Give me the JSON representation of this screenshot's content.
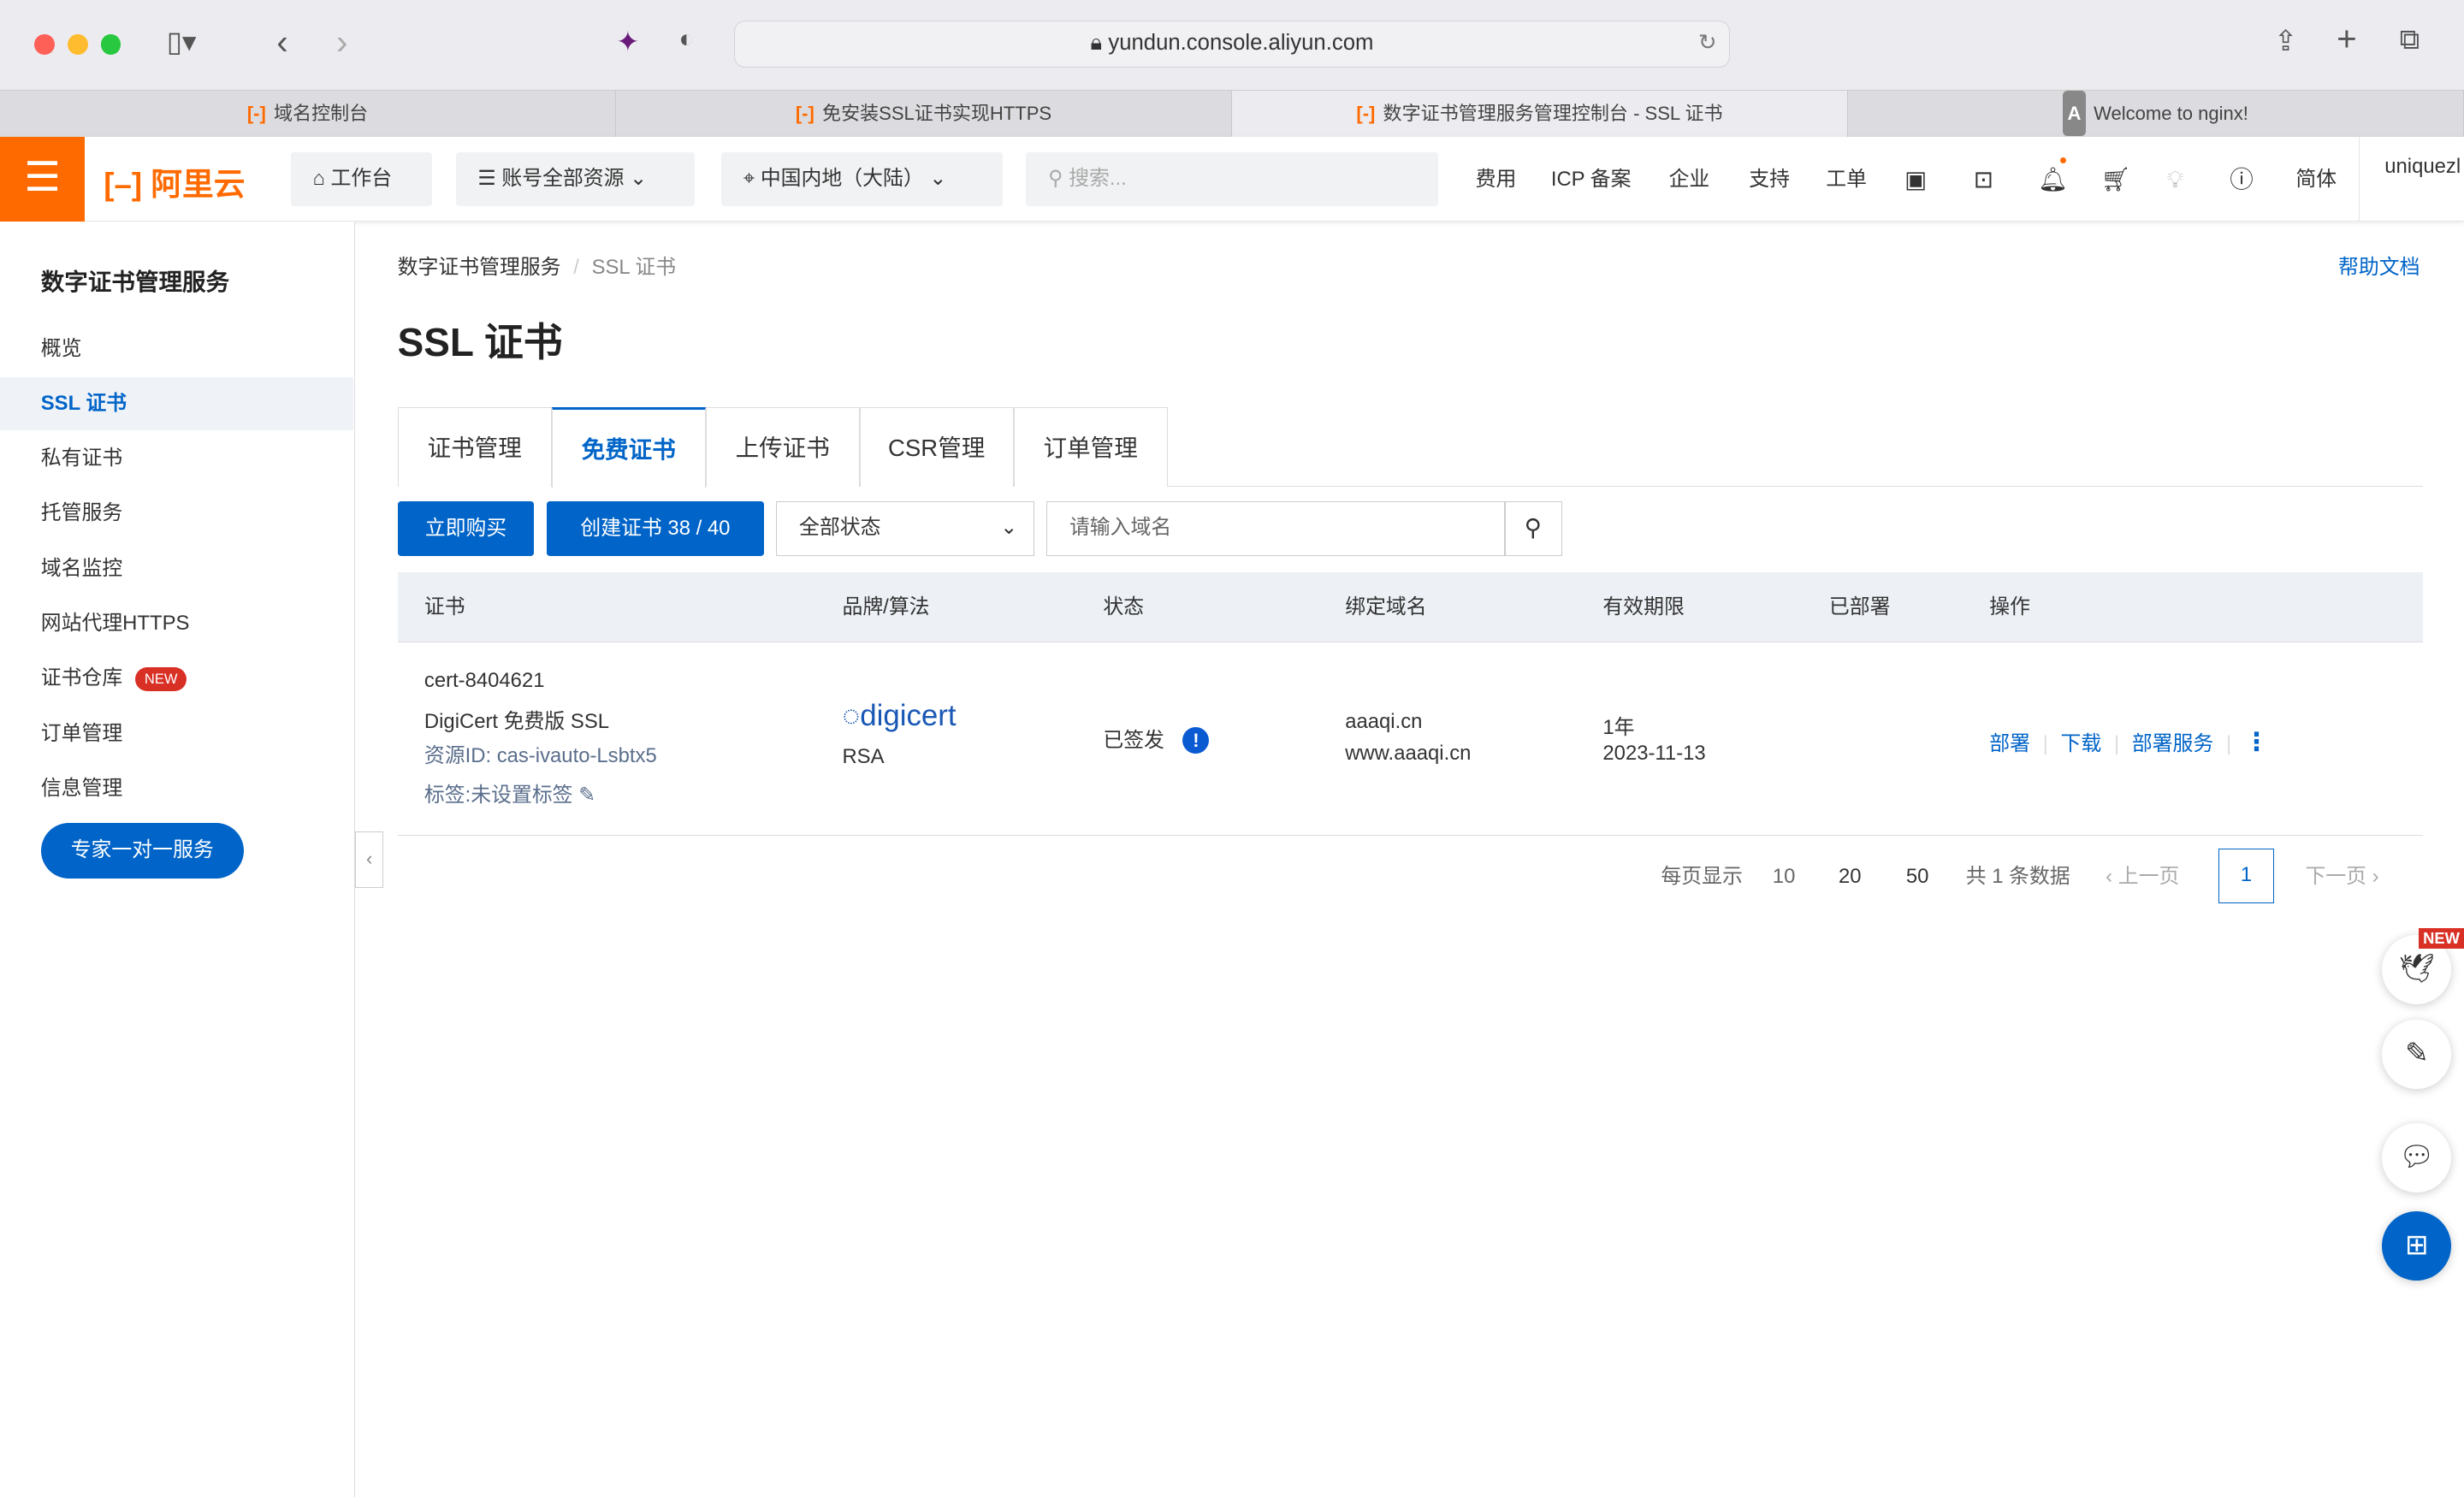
{
  "browser": {
    "url": "yundun.console.aliyun.com",
    "tabs": [
      {
        "label": "域名控制台"
      },
      {
        "label": "免安装SSL证书实现HTTPS"
      },
      {
        "label": "数字证书管理服务管理控制台 - SSL 证书"
      },
      {
        "label": "Welcome to nginx!"
      }
    ]
  },
  "topnav": {
    "logo": "阿里云",
    "workbench": "工作台",
    "resources": "账号全部资源",
    "region": "中国内地（大陆）",
    "search_placeholder": "搜索...",
    "links": [
      "费用",
      "ICP 备案",
      "企业",
      "支持",
      "工单"
    ],
    "lang": "简体",
    "user": "uniquezl"
  },
  "sidebar": {
    "title": "数字证书管理服务",
    "items": [
      {
        "label": "概览"
      },
      {
        "label": "SSL 证书"
      },
      {
        "label": "私有证书"
      },
      {
        "label": "托管服务"
      },
      {
        "label": "域名监控"
      },
      {
        "label": "网站代理HTTPS"
      },
      {
        "label": "证书仓库",
        "badge": "NEW"
      },
      {
        "label": "订单管理"
      },
      {
        "label": "信息管理"
      }
    ],
    "expert": "专家一对一服务"
  },
  "breadcrumb": [
    "数字证书管理服务",
    "SSL 证书"
  ],
  "help": "帮助文档",
  "page_title": "SSL 证书",
  "tabs": [
    "证书管理",
    "免费证书",
    "上传证书",
    "CSR管理",
    "订单管理"
  ],
  "toolbar": {
    "buy": "立即购买",
    "create": "创建证书 38 / 40",
    "status_filter": "全部状态",
    "domain_placeholder": "请输入域名"
  },
  "table": {
    "headers": [
      "证书",
      "品牌/算法",
      "状态",
      "绑定域名",
      "有效期限",
      "已部署",
      "操作"
    ],
    "rows": [
      {
        "name": "cert-8404621",
        "product": "DigiCert 免费版 SSL",
        "resource_id": "资源ID: cas-ivauto-Lsbtx5",
        "tag": "标签:未设置标签",
        "brand": "digicert",
        "algo": "RSA",
        "status": "已签发",
        "domains": [
          "aaaqi.cn",
          "www.aaaqi.cn"
        ],
        "period": "1年",
        "expires": "2023-11-13",
        "deployed": "",
        "actions": [
          "部署",
          "下载",
          "部署服务"
        ]
      }
    ]
  },
  "pagination": {
    "per_page_label": "每页显示",
    "sizes": [
      "10",
      "20",
      "50"
    ],
    "selected_size": "10",
    "total": "共 1 条数据",
    "prev": "上一页",
    "next": "下一页",
    "current": "1"
  },
  "float": {
    "new_badge": "NEW"
  },
  "colors": {
    "brand": "#ff6a00",
    "primary": "#0064c8"
  }
}
